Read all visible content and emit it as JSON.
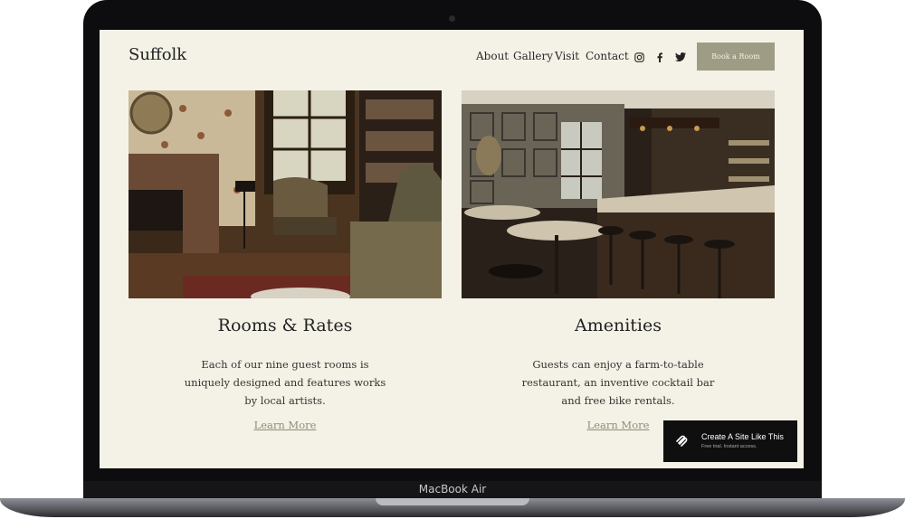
{
  "device": {
    "label": "MacBook Air"
  },
  "site": {
    "logo": "Suffolk",
    "nav": [
      "About",
      "Gallery",
      "Visit",
      "Contact"
    ],
    "social_icons": [
      "instagram-icon",
      "facebook-icon",
      "twitter-icon"
    ],
    "cta": "Book a Room"
  },
  "sections": [
    {
      "title": "Rooms & Rates",
      "body": "Each of our nine guest rooms is uniquely designed and features works by local artists.",
      "link": "Learn More"
    },
    {
      "title": "Amenities",
      "body": "Guests can enjoy a farm-to-table restaurant, an inventive cocktail bar and free bike rentals.",
      "link": "Learn More"
    }
  ],
  "badge": {
    "title": "Create A Site Like This",
    "subtitle": "Free trial. Instant access."
  },
  "colors": {
    "page_bg": "#f4f2e6",
    "button_bg": "#9e9c84",
    "link": "#8f8c7a"
  }
}
